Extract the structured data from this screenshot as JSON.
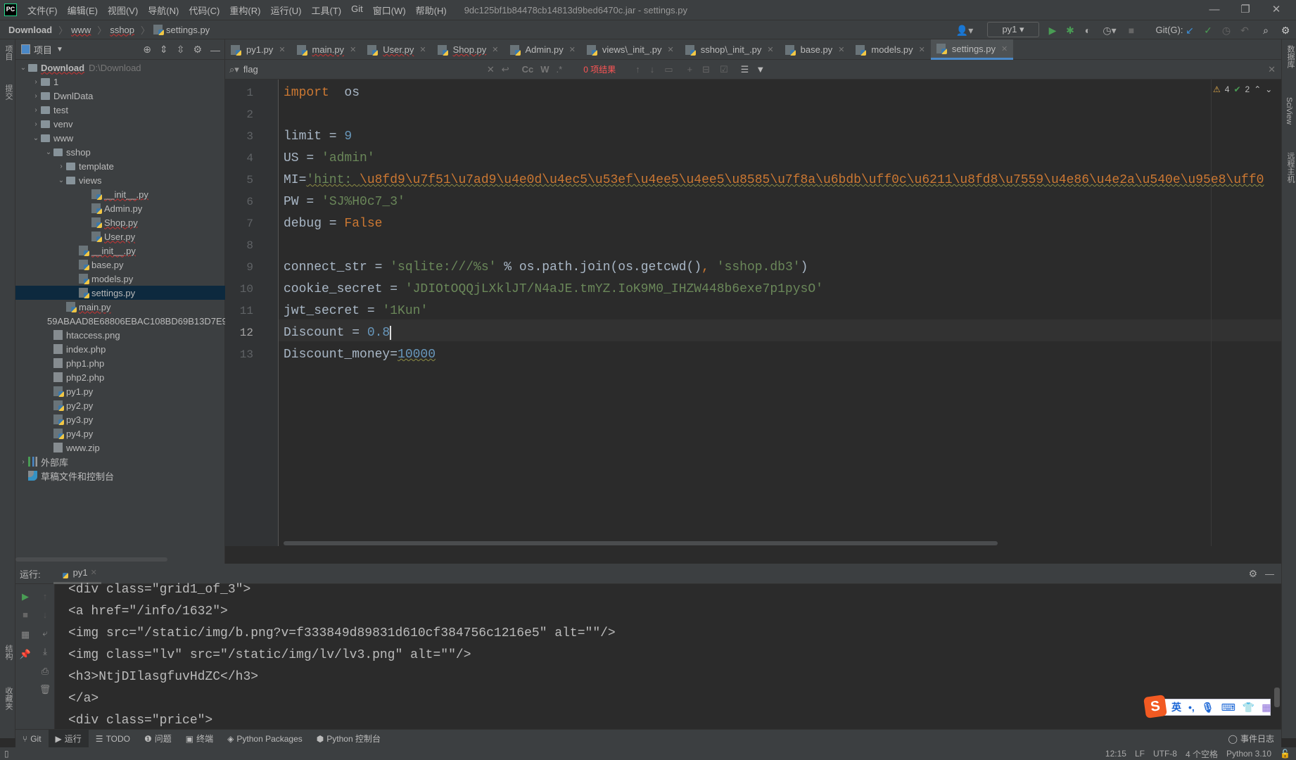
{
  "menubar": {
    "items": [
      "文件(F)",
      "编辑(E)",
      "视图(V)",
      "导航(N)",
      "代码(C)",
      "重构(R)",
      "运行(U)",
      "工具(T)",
      "Git",
      "窗口(W)",
      "帮助(H)"
    ],
    "title": "9dc125bf1b84478cb14813d9bed6470c.jar - settings.py"
  },
  "breadcrumb": [
    "Download",
    "www",
    "sshop",
    "settings.py"
  ],
  "toolbar": {
    "run_config": "py1",
    "git_label": "Git(G):"
  },
  "left_strip": {
    "project": "项目",
    "commit": "提交",
    "structure": "结构",
    "favorites": "收藏夹"
  },
  "right_strip": {
    "database": "数据库",
    "sciview": "SciView",
    "remote": "远程主机"
  },
  "sidebar": {
    "title": "项目",
    "tree": [
      {
        "label": "Download",
        "hint": "D:\\Download",
        "type": "folder",
        "depth": 0,
        "open": true
      },
      {
        "label": "1",
        "type": "folder",
        "depth": 1
      },
      {
        "label": "DwnlData",
        "type": "folder",
        "depth": 1
      },
      {
        "label": "test",
        "type": "folder",
        "depth": 1
      },
      {
        "label": "venv",
        "type": "folder",
        "depth": 1
      },
      {
        "label": "www",
        "type": "folder",
        "depth": 1,
        "open": true
      },
      {
        "label": "sshop",
        "type": "folder",
        "depth": 2,
        "open": true
      },
      {
        "label": "template",
        "type": "folder",
        "depth": 3
      },
      {
        "label": "views",
        "type": "folder",
        "depth": 3,
        "open": true
      },
      {
        "label": "__init__.py",
        "type": "py",
        "depth": 5
      },
      {
        "label": "Admin.py",
        "type": "py",
        "depth": 5
      },
      {
        "label": "Shop.py",
        "type": "py",
        "depth": 5
      },
      {
        "label": "User.py",
        "type": "py",
        "depth": 5
      },
      {
        "label": "__init__.py",
        "type": "py",
        "depth": 4
      },
      {
        "label": "base.py",
        "type": "py",
        "depth": 4
      },
      {
        "label": "models.py",
        "type": "py",
        "depth": 4
      },
      {
        "label": "settings.py",
        "type": "py",
        "depth": 4,
        "selected": true
      },
      {
        "label": "main.py",
        "type": "py",
        "depth": 3
      },
      {
        "label": "59ABAAD8E68806EBAC108BD69B13D7E9",
        "type": "unknown",
        "depth": 2
      },
      {
        "label": "htaccess.png",
        "type": "image",
        "depth": 2
      },
      {
        "label": "index.php",
        "type": "text",
        "depth": 2
      },
      {
        "label": "php1.php",
        "type": "unknown",
        "depth": 2
      },
      {
        "label": "php2.php",
        "type": "text",
        "depth": 2
      },
      {
        "label": "py1.py",
        "type": "py",
        "depth": 2
      },
      {
        "label": "py2.py",
        "type": "py",
        "depth": 2
      },
      {
        "label": "py3.py",
        "type": "py",
        "depth": 2
      },
      {
        "label": "py4.py",
        "type": "py",
        "depth": 2
      },
      {
        "label": "www.zip",
        "type": "zip",
        "depth": 2
      },
      {
        "label": "外部库",
        "type": "lib",
        "depth": 0
      },
      {
        "label": "草稿文件和控制台",
        "type": "scratch",
        "depth": 0
      }
    ]
  },
  "tabs": [
    {
      "label": "py1.py"
    },
    {
      "label": "main.py"
    },
    {
      "label": "User.py"
    },
    {
      "label": "Shop.py"
    },
    {
      "label": "Admin.py"
    },
    {
      "label": "views\\_init_.py"
    },
    {
      "label": "sshop\\_init_.py"
    },
    {
      "label": "base.py"
    },
    {
      "label": "models.py"
    },
    {
      "label": "settings.py",
      "active": true
    }
  ],
  "search": {
    "value": "flag",
    "result": "0 项结果",
    "cc": "Cc",
    "w": "W",
    "regex": ".*"
  },
  "editor": {
    "warnings": "4",
    "ok": "2",
    "current_line": 12,
    "lines": [
      [
        [
          "kw",
          "import"
        ],
        [
          "",
          "  os"
        ]
      ],
      [],
      [
        [
          "",
          "limit = "
        ],
        [
          "num",
          "9"
        ]
      ],
      [
        [
          "",
          "US = "
        ],
        [
          "str",
          "'admin'"
        ]
      ],
      [
        [
          "",
          "MI="
        ],
        [
          "str",
          "'hint: "
        ],
        [
          "kw",
          "\\u8fd9\\u7f51\\u7ad9\\u4e0d\\u4ec5\\u53ef\\u4ee5\\u4ee5\\u8585\\u7f8a\\u6bdb\\uff0c\\u6211\\u8fd8\\u7559\\u4e86\\u4e2a\\u540e\\u95e8\\uff0"
        ]
      ],
      [
        [
          "",
          "PW = "
        ],
        [
          "str",
          "'SJ%H0c7_3'"
        ]
      ],
      [
        [
          "",
          "debug = "
        ],
        [
          "kw",
          "False"
        ]
      ],
      [],
      [
        [
          "",
          "connect_str = "
        ],
        [
          "str",
          "'sqlite:///%s'"
        ],
        [
          "",
          " % os.path.join(os.getcwd()"
        ],
        [
          "kw",
          ","
        ],
        [
          "str",
          " 'sshop.db3'"
        ],
        [
          "",
          ")"
        ]
      ],
      [
        [
          "",
          "cookie_secret = "
        ],
        [
          "str",
          "'JDIOtOQQjLXklJT/N4aJE.tmYZ.IoK9M0_IHZW448b6exe7p1pysO'"
        ]
      ],
      [
        [
          "",
          "jwt_secret = "
        ],
        [
          "str",
          "'1Kun'"
        ]
      ],
      [
        [
          "",
          "Discount = "
        ],
        [
          "num",
          "0.8"
        ]
      ],
      [
        [
          "",
          "Discount_money="
        ],
        [
          "num",
          "10000"
        ]
      ]
    ]
  },
  "run": {
    "label": "运行:",
    "tab": "py1",
    "output": [
      "<div class=\"grid1_of_3\">",
      "<a href=\"/info/1632\">",
      "<img src=\"/static/img/b.png?v=f333849d89831d610cf384756c1216e5\" alt=\"\"/>",
      "<img class=\"lv\" src=\"/static/img/lv/lv3.png\" alt=\"\"/>",
      "<h3>NtjDIlasgfuvHdZC</h3>",
      "</a>",
      "<div class=\"price\">"
    ]
  },
  "bottom_tools": [
    {
      "label": "Git",
      "icon": "git-branch-icon"
    },
    {
      "label": "运行",
      "icon": "play-icon",
      "active": true
    },
    {
      "label": "TODO",
      "icon": "list-icon"
    },
    {
      "label": "问题",
      "icon": "info-icon"
    },
    {
      "label": "终端",
      "icon": "terminal-icon"
    },
    {
      "label": "Python Packages",
      "icon": "layers-icon"
    },
    {
      "label": "Python 控制台",
      "icon": "python-icon"
    }
  ],
  "event_log": "事件日志",
  "status": {
    "position": "12:15",
    "line_sep": "LF",
    "encoding": "UTF-8",
    "indent": "4 个空格",
    "interpreter": "Python 3.10"
  },
  "ime": {
    "lang": "英",
    "punct": "•,"
  },
  "colors": {
    "accent": "#4a88c7",
    "keyword": "#cc7832",
    "string": "#6a8759",
    "number": "#6897bb",
    "run": "#499c54"
  }
}
